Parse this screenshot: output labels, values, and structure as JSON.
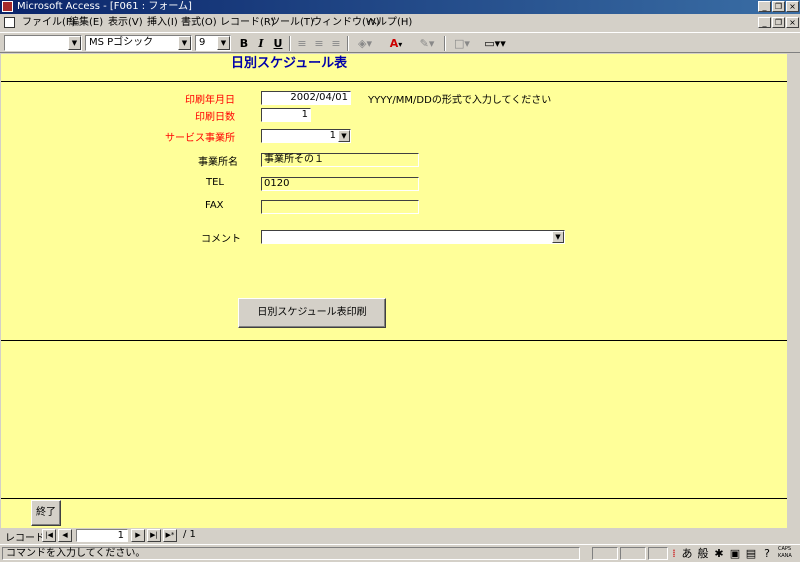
{
  "window": {
    "title": "Microsoft Access - [F061 : フォーム]"
  },
  "menu": {
    "items": [
      {
        "label": "ファイル(F)"
      },
      {
        "label": "編集(E)"
      },
      {
        "label": "表示(V)"
      },
      {
        "label": "挿入(I)"
      },
      {
        "label": "書式(O)"
      },
      {
        "label": "レコード(R)"
      },
      {
        "label": "ツール(T)"
      },
      {
        "label": "ウィンドウ(W)"
      },
      {
        "label": "ヘルプ(H)"
      }
    ]
  },
  "toolbar": {
    "object_combo": "",
    "font_name": "MS Pゴシック",
    "font_size": "9",
    "bold": "B",
    "italic": "I",
    "underline": "U",
    "font_color_glyph": "A"
  },
  "form": {
    "title": "日別スケジュール表",
    "fields": {
      "print_date": {
        "label": "印刷年月日",
        "value": "2002/04/01",
        "hint": "YYYY/MM/DDの形式で入力してください"
      },
      "print_days": {
        "label": "印刷日数",
        "value": "1"
      },
      "service_office": {
        "label": "サービス事業所",
        "value": "1"
      },
      "office_name": {
        "label": "事業所名",
        "value": "事業所その１"
      },
      "tel": {
        "label": "TEL",
        "value": "0120"
      },
      "fax": {
        "label": "FAX",
        "value": ""
      },
      "comment": {
        "label": "コメント",
        "value": ""
      }
    },
    "print_button": "日別スケジュール表印刷",
    "close_button": "終了"
  },
  "record_nav": {
    "label": "レコード:",
    "current": "1",
    "total": "/ 1"
  },
  "status": {
    "text": "コマンドを入力してください。",
    "caps": "CAPS",
    "kana": "KANA",
    "ime_a": "あ",
    "ime_mode": "般"
  },
  "colors": {
    "form_bg": "#ffff99",
    "label_red": "#ff0000",
    "title_blue": "#0000aa",
    "chrome": "#d4d0c8"
  }
}
